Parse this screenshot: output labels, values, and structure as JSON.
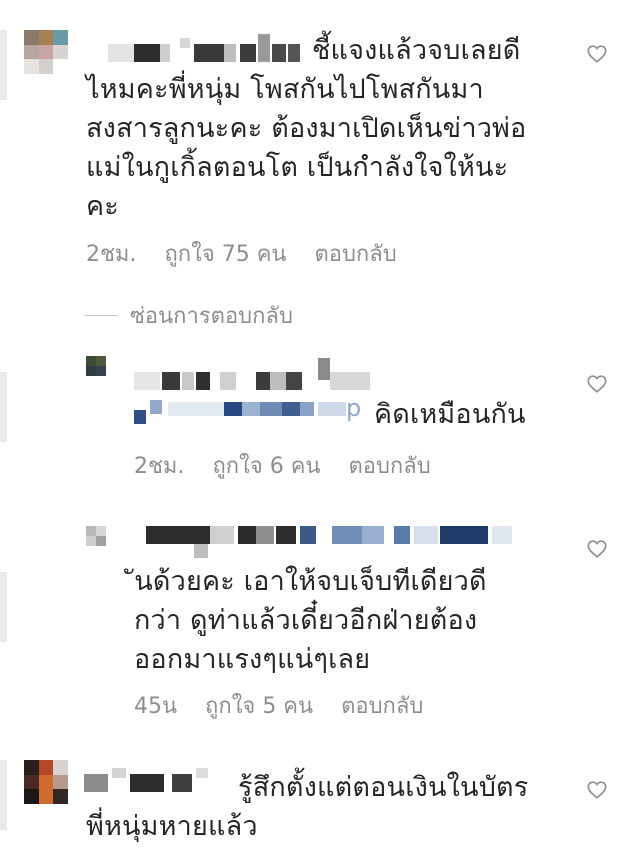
{
  "comments": [
    {
      "text": "ชี้แจงแล้วจบเลยดี\nไหมคะพี่หนุ่ม โพสกันไปโพสกันมา\nสงสารลูกนะคะ ต้องมาเปิดเห็นข่าวพ่อ\nแม่ในกูเกิ้ลตอนโต เป็นกำลังใจให้นะ\nคะ",
      "time": "2ชม.",
      "likes": "ถูกใจ 75 คน",
      "reply": "ตอบกลับ"
    },
    {
      "text": "คิดเหมือนกัน",
      "time": "2ชม.",
      "likes": "ถูกใจ 6 คน",
      "reply": "ตอบกลับ"
    },
    {
      "text": "ันด้วยคะ เอาให้จบเจ็บทีเดียวดี\nกว่า ดูท่าแล้วเดี๋ยวอีกฝ่ายต้อง\nออกมาแรงๆแน่ๆเลย",
      "time": "45น",
      "likes": "ถูกใจ 5 คน",
      "reply": "ตอบกลับ"
    },
    {
      "text": "รู้สึกตั้งแต่ตอนเงินในบัตร\nพี่หนุ่มหายแล้ว"
    }
  ],
  "hide_replies": "ซ่อนการตอบกลับ",
  "mention_suffix": "p",
  "colors": {
    "text": "#262626",
    "secondary": "#8e8e8e",
    "heart": "#8e8e8e"
  }
}
